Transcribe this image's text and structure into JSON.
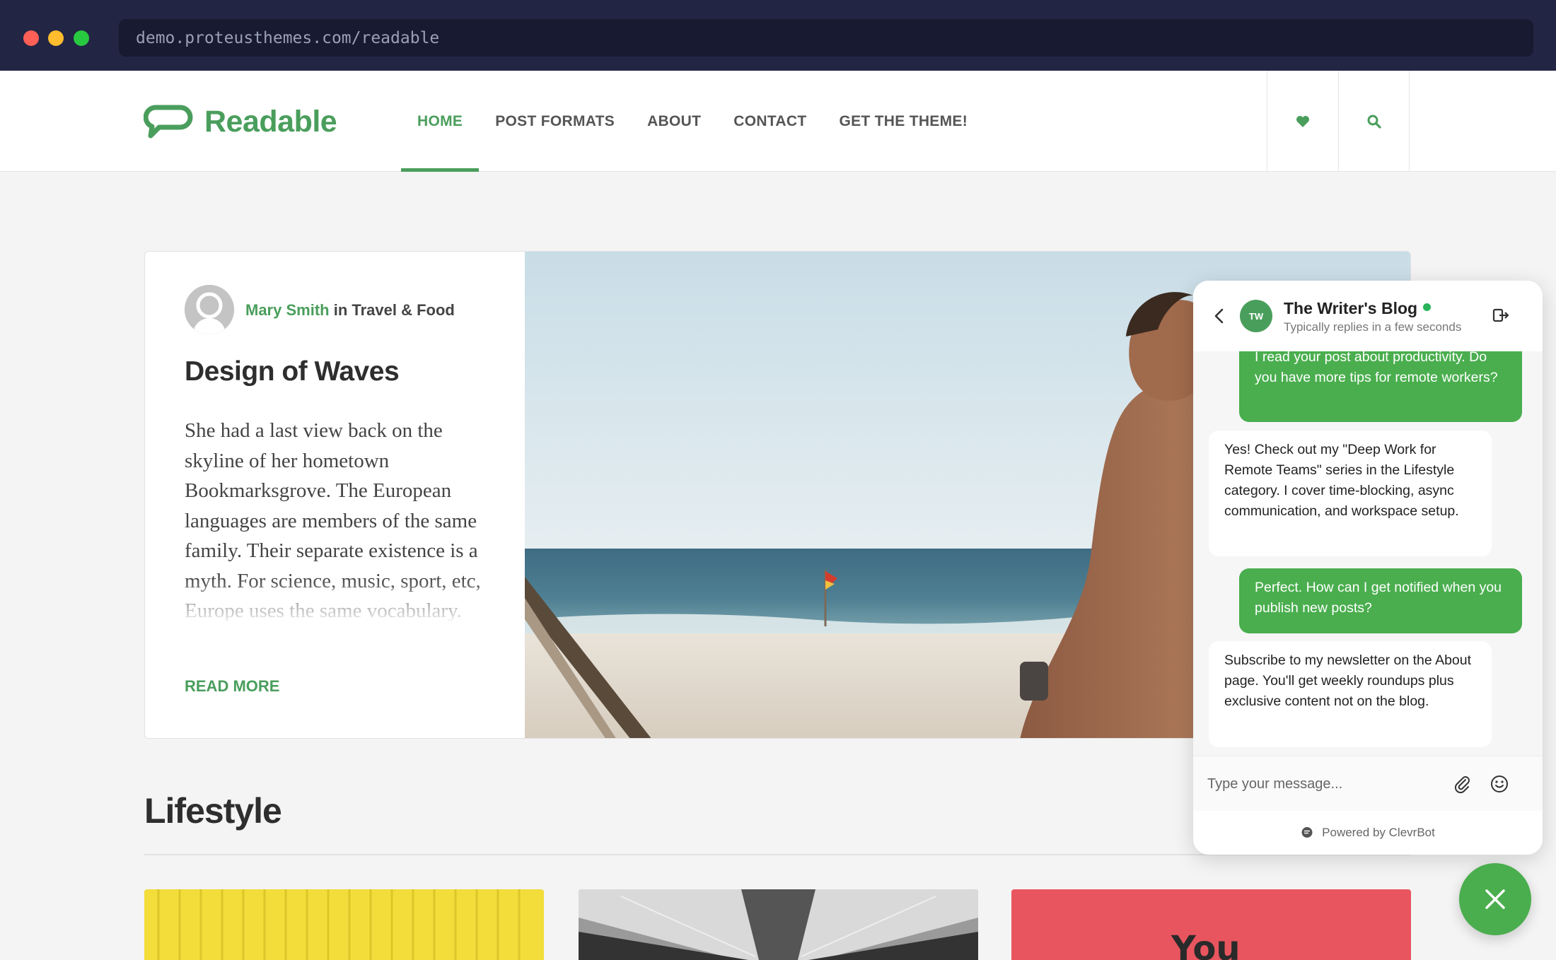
{
  "browser": {
    "url": "demo.proteusthemes.com/readable"
  },
  "site": {
    "logo_text": "Readable",
    "nav": [
      {
        "label": "HOME",
        "active": true
      },
      {
        "label": "POST FORMATS"
      },
      {
        "label": "ABOUT"
      },
      {
        "label": "CONTACT"
      },
      {
        "label": "GET THE THEME!"
      }
    ],
    "header_icons": [
      "heart-icon",
      "search-icon"
    ]
  },
  "featured": {
    "author": "Mary Smith",
    "in_text": " in ",
    "category": "Travel & Food",
    "title": "Design of Waves",
    "excerpt": "She had a last view back on the skyline of her hometown Bookmarksgrove. The European languages are members of the same family. Their separate existence is a myth. For science, music, sport, etc, Europe uses the same vocabulary. The languages",
    "read_more": "READ MORE"
  },
  "lifestyle": {
    "title": "Lifestyle",
    "thumb3_text": "You"
  },
  "chat": {
    "name": "The Writer's Blog",
    "avatar_initials": "TW",
    "status": "Typically replies in a few seconds",
    "messages": [
      {
        "from": "user",
        "text": "I read your post about productivity. Do you have more tips for remote workers?"
      },
      {
        "from": "bot",
        "text": "Yes! Check out my \"Deep Work for Remote Teams\" series in the Lifestyle category. I cover time-blocking, async communication, and workspace setup."
      },
      {
        "from": "user",
        "text": "Perfect. How can I get notified when you publish new posts?"
      },
      {
        "from": "bot",
        "text": "Subscribe to my newsletter on the About page. You'll get weekly roundups plus exclusive content not on the blog."
      }
    ],
    "input_placeholder": "Type your message...",
    "footer": "Powered by ClevrBot"
  },
  "colors": {
    "brand_green": "#4a9e5c",
    "chat_green": "#4aae4e",
    "chrome_bg": "#232544"
  }
}
